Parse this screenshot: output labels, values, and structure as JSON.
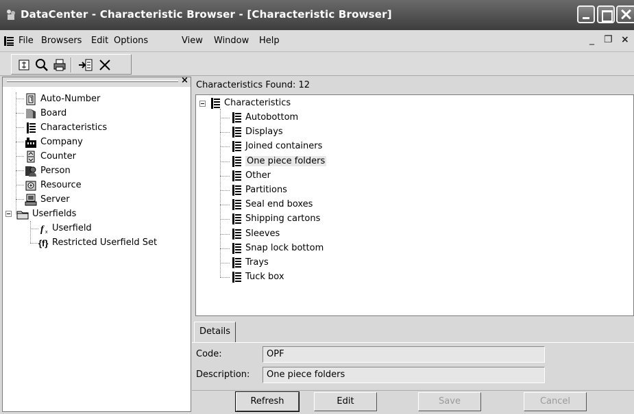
{
  "window": {
    "title": "DataCenter - Characteristic Browser - [Characteristic Browser]"
  },
  "menu": {
    "items": [
      "File",
      "Browsers",
      "Edit",
      "Options",
      "View",
      "Window",
      "Help"
    ],
    "mdi_minimize": "_",
    "mdi_restore": "❐",
    "mdi_close": "×"
  },
  "toolbar": {
    "buttons": [
      "refresh-icon",
      "search-icon",
      "print-icon",
      "insert-icon",
      "delete-icon"
    ]
  },
  "left_tree": {
    "close_label": "×",
    "items": [
      {
        "label": "Auto-Number",
        "icon": "auto-number-icon"
      },
      {
        "label": "Board",
        "icon": "board-icon"
      },
      {
        "label": "Characteristics",
        "icon": "characteristics-icon"
      },
      {
        "label": "Company",
        "icon": "company-icon"
      },
      {
        "label": "Counter",
        "icon": "counter-icon"
      },
      {
        "label": "Person",
        "icon": "person-icon"
      },
      {
        "label": "Resource",
        "icon": "resource-icon"
      },
      {
        "label": "Server",
        "icon": "server-icon"
      },
      {
        "label": "Userfields",
        "icon": "folder-icon"
      },
      {
        "label": "Userfield",
        "icon": "userfield-icon"
      },
      {
        "label": "Restricted Userfield Set",
        "icon": "userfield-set-icon"
      }
    ]
  },
  "results": {
    "found_label": "Characteristics Found: 12",
    "root": "Characteristics",
    "items": [
      "Autobottom",
      "Displays",
      "Joined containers",
      "One piece folders",
      "Other",
      "Partitions",
      "Seal end boxes",
      "Shipping cartons",
      "Sleeves",
      "Snap lock bottom",
      "Trays",
      "Tuck box"
    ],
    "selected": "One piece folders"
  },
  "details": {
    "tab_label": "Details",
    "code_label": "Code:",
    "code_value": "OPF",
    "description_label": "Description:",
    "description_value": "One piece folders"
  },
  "buttons": {
    "refresh": "Refresh",
    "edit": "Edit",
    "save": "Save",
    "cancel": "Cancel"
  },
  "colors": {
    "titlebar": "#4a4a4a",
    "window_bg": "#d8d8d8",
    "selection": "#e8e8e8"
  }
}
